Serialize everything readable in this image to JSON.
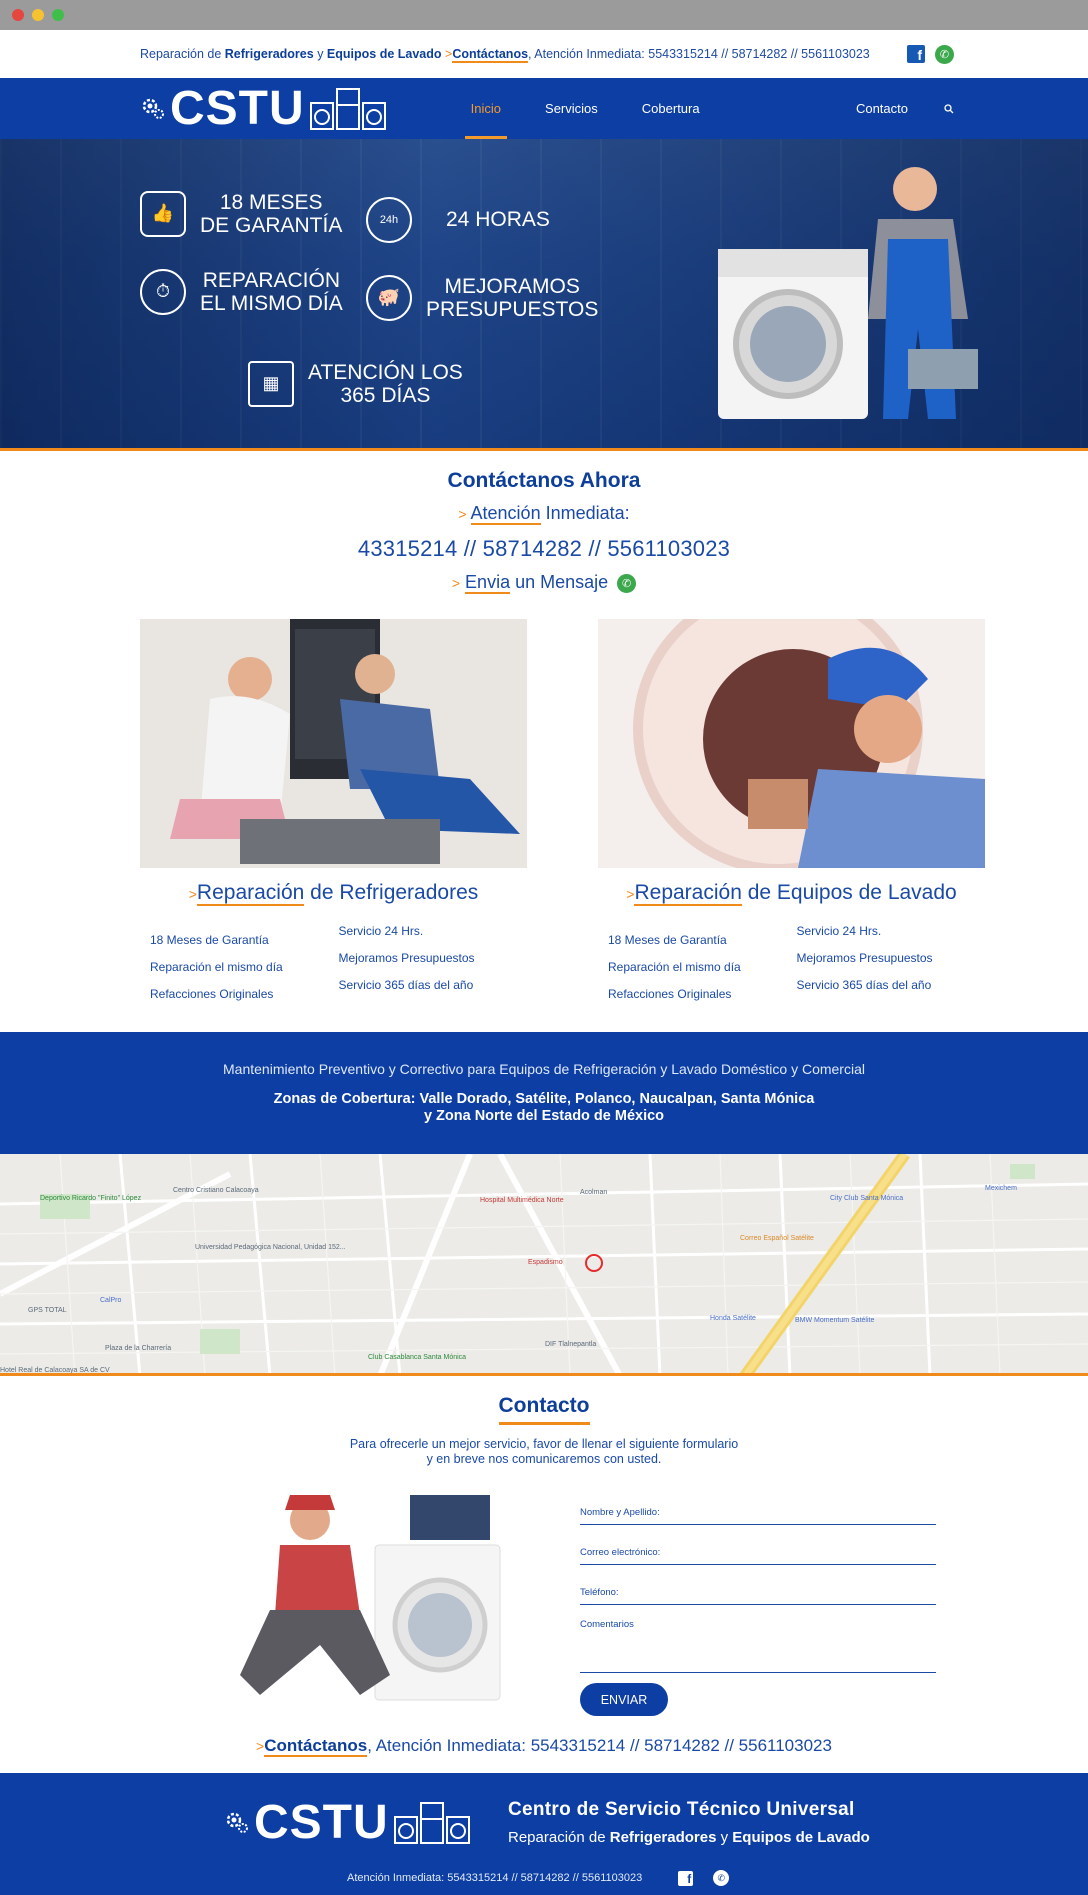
{
  "window": {
    "dots": [
      "#e5463d",
      "#f5c230",
      "#3fbf4a"
    ]
  },
  "topbar": {
    "text_pre": "Reparación de ",
    "bold1": "Refrigeradores",
    "mid": " y ",
    "bold2": "Equipos de Lavado",
    "arrow": ">",
    "cta": "Contáctanos",
    "attention": ", Atención Inmediata: 5543315214 // 58714282 // 5561103023",
    "facebook_icon": "facebook-icon",
    "whatsapp_icon": "whatsapp-icon"
  },
  "nav": {
    "logo": "CSTU",
    "items": [
      "Inicio",
      "Servicios",
      "Cobertura"
    ],
    "active": "Inicio",
    "contact": "Contacto",
    "search_icon": "search-icon"
  },
  "hero": {
    "f1": "18 MESES\nDE GARANTÍA",
    "f2": "24 HORAS",
    "f2_badge": "24h",
    "f3": "REPARACIÓN\nEL MISMO DÍA",
    "f4": "MEJORAMOS\nPRESUPUESTOS",
    "f5": "ATENCIÓN LOS\n365 DÍAS"
  },
  "contact_now": {
    "title": "Contáctanos Ahora",
    "arrow": ">",
    "attention_u": "Atención",
    "attention_rest": " Inmediata:",
    "phones": "43315214 // 58714282 // 5561103023",
    "send_u": "Envia",
    "send_rest": " un Mensaje"
  },
  "services": [
    {
      "title_u": "Reparación",
      "title_rest": " de Refrigeradores",
      "col1": [
        "18 Meses de Garantía",
        "Reparación el mismo día",
        "Refacciones Originales"
      ],
      "col2": [
        "Servicio 24 Hrs.",
        "Mejoramos Presupuestos",
        "Servicio 365 días del año"
      ]
    },
    {
      "title_u": "Reparación",
      "title_rest": " de Equipos de Lavado",
      "col1": [
        "18 Meses de Garantía",
        "Reparación el mismo día",
        "Refacciones Originales"
      ],
      "col2": [
        "Servicio 24 Hrs.",
        "Mejoramos Presupuestos",
        "Servicio 365 días del año"
      ]
    }
  ],
  "band": {
    "line1": "Mantenimiento Preventivo y Correctivo para Equipos de Refrigeración y Lavado Doméstico y Comercial",
    "line2a": "Zonas de Cobertura: Valle Dorado, Satélite, Polanco, Naucalpan, Santa Mónica",
    "line2b": "y Zona Norte del Estado de México"
  },
  "map": {
    "labels": [
      "Centro Cristiano Calacoaya",
      "Deportivo Ricardo \"Finito\" López",
      "Hospital Multimédica Norte",
      "Acolman",
      "City Club Santa Mónica",
      "Mexichem",
      "Correo Español Satélite",
      "Espadismo",
      "Universidad Pedagógica Nacional, Unidad 152...",
      "Honda Satélite",
      "BMW Momentum Satélite",
      "GPS TOTAL",
      "CalPro",
      "Plaza de la Charrería",
      "DIF Tlalnepantla",
      "Club Casablanca Santa Mónica",
      "Hotel Real de Calacoaya SA de CV"
    ]
  },
  "contact": {
    "title": "Contacto",
    "desc1": "Para ofrecerle un mejor servicio, favor de llenar el siguiente formulario",
    "desc2": "y en breve nos comunicaremos con usted.",
    "f_name": "Nombre y Apellido:",
    "f_email": "Correo electrónico:",
    "f_phone": "Teléfono:",
    "f_comments": "Comentarios",
    "submit": "ENVIAR"
  },
  "bottom": {
    "arrow": ">",
    "cta": "Contáctanos",
    "rest": ", Atención Inmediata: 5543315214 // 58714282 // 5561103023"
  },
  "footer": {
    "logo": "CSTU",
    "title": "Centro de Servicio Técnico Universal",
    "sub_pre": "Reparación de ",
    "sub_b1": "Refrigeradores",
    "sub_mid": " y ",
    "sub_b2": "Equipos de Lavado",
    "attention": "Atención Inmediata: 5543315214 // 58714282 // 5561103023"
  }
}
